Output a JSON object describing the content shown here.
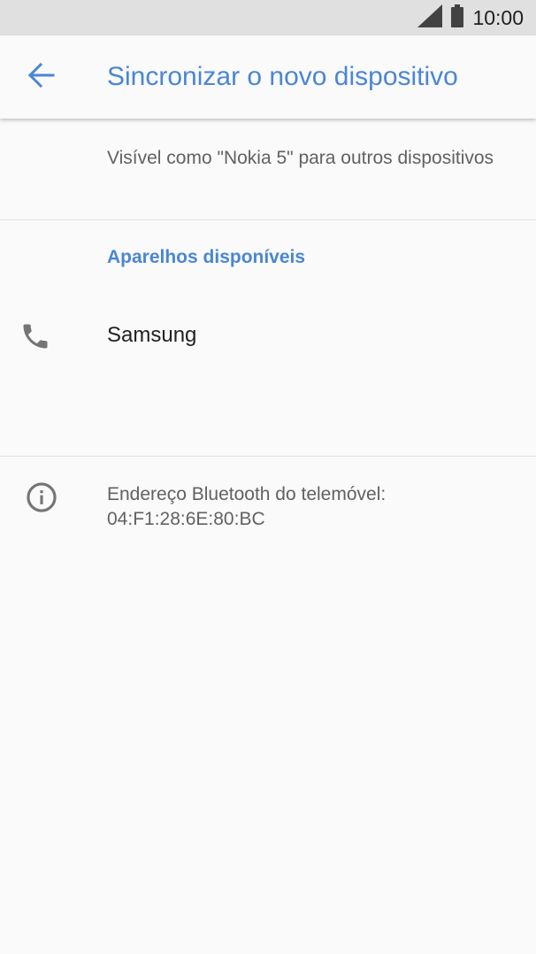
{
  "status_bar": {
    "time": "10:00",
    "icons": [
      "signal-icon",
      "battery-icon"
    ]
  },
  "app_bar": {
    "back_icon": "arrow-left-icon",
    "title": "Sincronizar o novo dispositivo"
  },
  "visibility": {
    "text": "Visível como \"Nokia 5\" para outros dispositivos"
  },
  "available_devices": {
    "header": "Aparelhos disponíveis",
    "items": [
      {
        "icon": "phone-icon",
        "name": "Samsung"
      }
    ]
  },
  "info": {
    "icon": "info-icon",
    "text": "Endereço Bluetooth do telemóvel: 04:F1:28:6E:80:BC"
  },
  "colors": {
    "accent": "#4a86d4",
    "status_bar_bg": "#e0e0e0",
    "background": "#fafafa",
    "secondary_text": "#616161",
    "icon_gray": "#757575"
  }
}
